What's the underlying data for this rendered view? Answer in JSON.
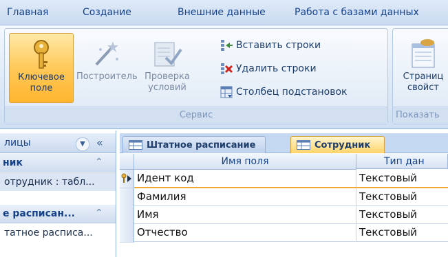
{
  "ribbon_tabs": [
    "Главная",
    "Создание",
    "Внешние данные",
    "Работа с базами данных"
  ],
  "ribbon": {
    "key_field_label": "Ключевое\nполе",
    "builder_label": "Построитель",
    "validation_label": "Проверка\nусловий",
    "insert_rows_label": "Вставить строки",
    "delete_rows_label": "Удалить строки",
    "lookup_column_label": "Столбец подстановок",
    "service_group_label": "Сервис",
    "property_sheet_label": "Страниц\nсвойст",
    "show_group_label": "Показать"
  },
  "nav": {
    "header_label": "лицы",
    "group1_label": "ник",
    "group1_item": "отрудник : табл...",
    "group2_label": "е расписан...",
    "group2_item": "татное расписа..."
  },
  "doc_tabs": [
    "Штатное расписание",
    "Сотрудник"
  ],
  "grid": {
    "columns": [
      "Имя поля",
      "Тип дан"
    ],
    "rows": [
      {
        "name": "Идент код",
        "type": "Текстовый"
      },
      {
        "name": "Фамилия",
        "type": "Текстовый"
      },
      {
        "name": "Имя",
        "type": "Текстовый"
      },
      {
        "name": "Отчество",
        "type": "Текстовый"
      }
    ]
  }
}
